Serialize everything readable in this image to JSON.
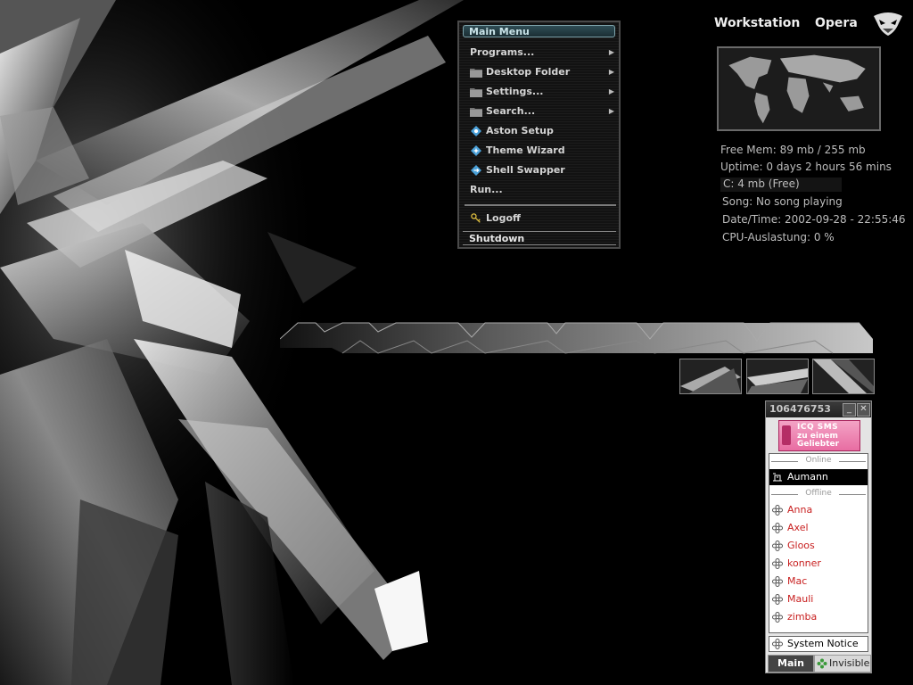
{
  "top_links": {
    "workstation": "Workstation",
    "opera": "Opera"
  },
  "system_info": {
    "free_mem": "Free Mem: 89 mb / 255 mb",
    "uptime": "Uptime: 0 days 2 hours 56 mins",
    "disk": "C: 4 mb (Free)",
    "song": "Song: No song playing",
    "datetime": "Date/Time: 2002-09-28 - 22:55:46",
    "cpu": "CPU-Auslastung: 0 %"
  },
  "main_menu": {
    "title": "Main Menu",
    "items": [
      {
        "label": "Programs...",
        "icon": "none",
        "submenu": true
      },
      {
        "label": "Desktop Folder",
        "icon": "folder-icon",
        "submenu": true
      },
      {
        "label": "Settings...",
        "icon": "folder-icon",
        "submenu": true
      },
      {
        "label": "Search...",
        "icon": "folder-icon",
        "submenu": true
      },
      {
        "label": "Aston Setup",
        "icon": "aston-setup-icon",
        "submenu": false
      },
      {
        "label": "Theme Wizard",
        "icon": "theme-wizard-icon",
        "submenu": false
      },
      {
        "label": "Shell Swapper",
        "icon": "shell-swapper-icon",
        "submenu": false
      },
      {
        "label": "Run...",
        "icon": "none",
        "submenu": false
      }
    ],
    "logoff": "Logoff",
    "shutdown": "Shutdown"
  },
  "icq": {
    "uin": "106476753",
    "minimize": "_",
    "close": "✕",
    "banner": {
      "line1": "ICQ SMS",
      "line2": "zu einem",
      "line3": "Geliebter"
    },
    "groups": {
      "online": "Online",
      "offline": "Offline"
    },
    "online_contacts": [
      "Aumann"
    ],
    "offline_contacts": [
      "Anna",
      "Axel",
      "Gloos",
      "konner",
      "Mac",
      "Mauli",
      "zimba"
    ],
    "system_notice": "System Notice",
    "main_button": "Main",
    "status_button": "Invisible"
  },
  "colors": {
    "menu_title": "#2f4d55",
    "offline_contact": "#c82020",
    "banner": "#e86da2"
  }
}
